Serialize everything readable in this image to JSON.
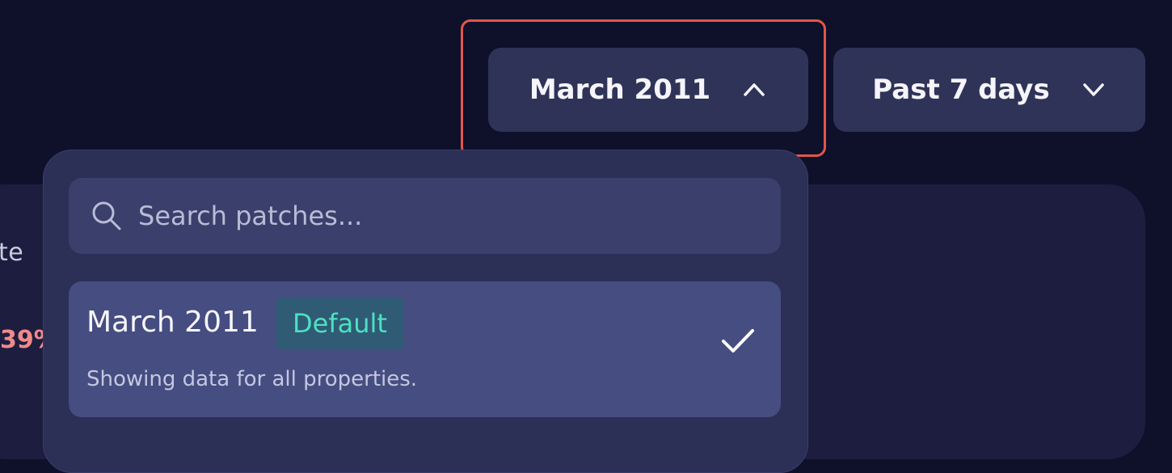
{
  "toolbar": {
    "patch_label": "March 2011",
    "range_label": "Past 7 days"
  },
  "background_card": {
    "label_partial": "te",
    "value_partial": "39%",
    "value_color": "#f08a8a"
  },
  "dropdown": {
    "search": {
      "placeholder": "Search patches...",
      "value": "",
      "icon": "search-icon"
    },
    "options": [
      {
        "title": "March 2011",
        "badge": "Default",
        "description": "Showing data for all properties.",
        "selected": true,
        "selected_icon": "check-icon"
      }
    ]
  },
  "colors": {
    "page_bg": "#0f1029",
    "button_bg": "#2f3358",
    "dropdown_bg": "#2c3057",
    "option_selected_bg": "#464d80",
    "badge_text": "#4de0c2",
    "focus_ring": "#e0574a"
  }
}
